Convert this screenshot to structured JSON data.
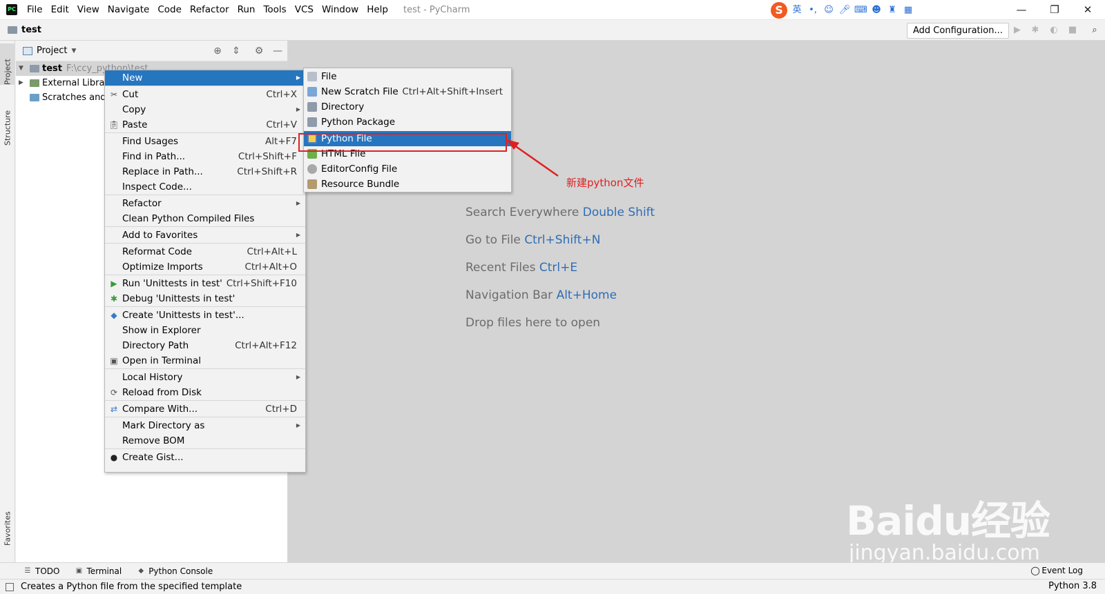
{
  "titlebar": {
    "menu": [
      "File",
      "Edit",
      "View",
      "Navigate",
      "Code",
      "Refactor",
      "Run",
      "Tools",
      "VCS",
      "Window",
      "Help"
    ],
    "window_title": "test - PyCharm",
    "ime_lang": "英",
    "ime_logo": "S"
  },
  "navbar": {
    "crumb": "test",
    "add_configuration": "Add Configuration..."
  },
  "left_stripe": {
    "project_tab": "Project",
    "structure_tab": "Structure",
    "favorites_tab": "Favorites"
  },
  "project_panel": {
    "title": "Project",
    "tree": [
      {
        "label": "test",
        "path": "F:\\ccy_python\\test"
      },
      {
        "label": "External Libraries"
      },
      {
        "label": "Scratches and Consoles"
      }
    ]
  },
  "context_menu": {
    "items": [
      {
        "label": "New",
        "shortcut": "",
        "submenu": true
      },
      {
        "label": "Cut",
        "shortcut": "Ctrl+X"
      },
      {
        "label": "Copy",
        "shortcut": "",
        "submenu": true
      },
      {
        "label": "Paste",
        "shortcut": "Ctrl+V"
      },
      {
        "label": "Find Usages",
        "shortcut": "Alt+F7"
      },
      {
        "label": "Find in Path...",
        "shortcut": "Ctrl+Shift+F"
      },
      {
        "label": "Replace in Path...",
        "shortcut": "Ctrl+Shift+R"
      },
      {
        "label": "Inspect Code...",
        "shortcut": ""
      },
      {
        "label": "Refactor",
        "shortcut": "",
        "submenu": true
      },
      {
        "label": "Clean Python Compiled Files",
        "shortcut": ""
      },
      {
        "label": "Add to Favorites",
        "shortcut": "",
        "submenu": true
      },
      {
        "label": "Reformat Code",
        "shortcut": "Ctrl+Alt+L"
      },
      {
        "label": "Optimize Imports",
        "shortcut": "Ctrl+Alt+O"
      },
      {
        "label": "Run 'Unittests in test'",
        "shortcut": "Ctrl+Shift+F10"
      },
      {
        "label": "Debug 'Unittests in test'",
        "shortcut": ""
      },
      {
        "label": "Create 'Unittests in test'...",
        "shortcut": ""
      },
      {
        "label": "Show in Explorer",
        "shortcut": ""
      },
      {
        "label": "Directory Path",
        "shortcut": "Ctrl+Alt+F12"
      },
      {
        "label": "Open in Terminal",
        "shortcut": ""
      },
      {
        "label": "Local History",
        "shortcut": "",
        "submenu": true
      },
      {
        "label": "Reload from Disk",
        "shortcut": ""
      },
      {
        "label": "Compare With...",
        "shortcut": "Ctrl+D"
      },
      {
        "label": "Mark Directory as",
        "shortcut": "",
        "submenu": true
      },
      {
        "label": "Remove BOM",
        "shortcut": ""
      },
      {
        "label": "Create Gist...",
        "shortcut": ""
      }
    ]
  },
  "new_submenu": {
    "items": [
      {
        "label": "File",
        "shortcut": ""
      },
      {
        "label": "New Scratch File",
        "shortcut": "Ctrl+Alt+Shift+Insert"
      },
      {
        "label": "Directory",
        "shortcut": ""
      },
      {
        "label": "Python Package",
        "shortcut": ""
      },
      {
        "label": "Python File",
        "shortcut": ""
      },
      {
        "label": "HTML File",
        "shortcut": ""
      },
      {
        "label": "EditorConfig File",
        "shortcut": ""
      },
      {
        "label": "Resource Bundle",
        "shortcut": ""
      }
    ]
  },
  "annotation": "新建python文件",
  "editor_hints": [
    {
      "text": "Search Everywhere",
      "shortcut": "Double Shift"
    },
    {
      "text": "Go to File",
      "shortcut": "Ctrl+Shift+N"
    },
    {
      "text": "Recent Files",
      "shortcut": "Ctrl+E"
    },
    {
      "text": "Navigation Bar",
      "shortcut": "Alt+Home"
    },
    {
      "text": "Drop files here to open",
      "shortcut": ""
    }
  ],
  "bottom_tools": {
    "todo": "TODO",
    "terminal": "Terminal",
    "python_console": "Python Console",
    "event_log": "Event Log"
  },
  "statusbar": {
    "message": "Creates a Python file from the specified template",
    "interpreter": "Python 3.8"
  },
  "watermark": {
    "brand": "Baidu经验",
    "url": "jingyan.baidu.com"
  },
  "colors": {
    "selection": "#2675bf",
    "annotation": "#e02020",
    "shortcut_hint": "#2f6db4"
  }
}
